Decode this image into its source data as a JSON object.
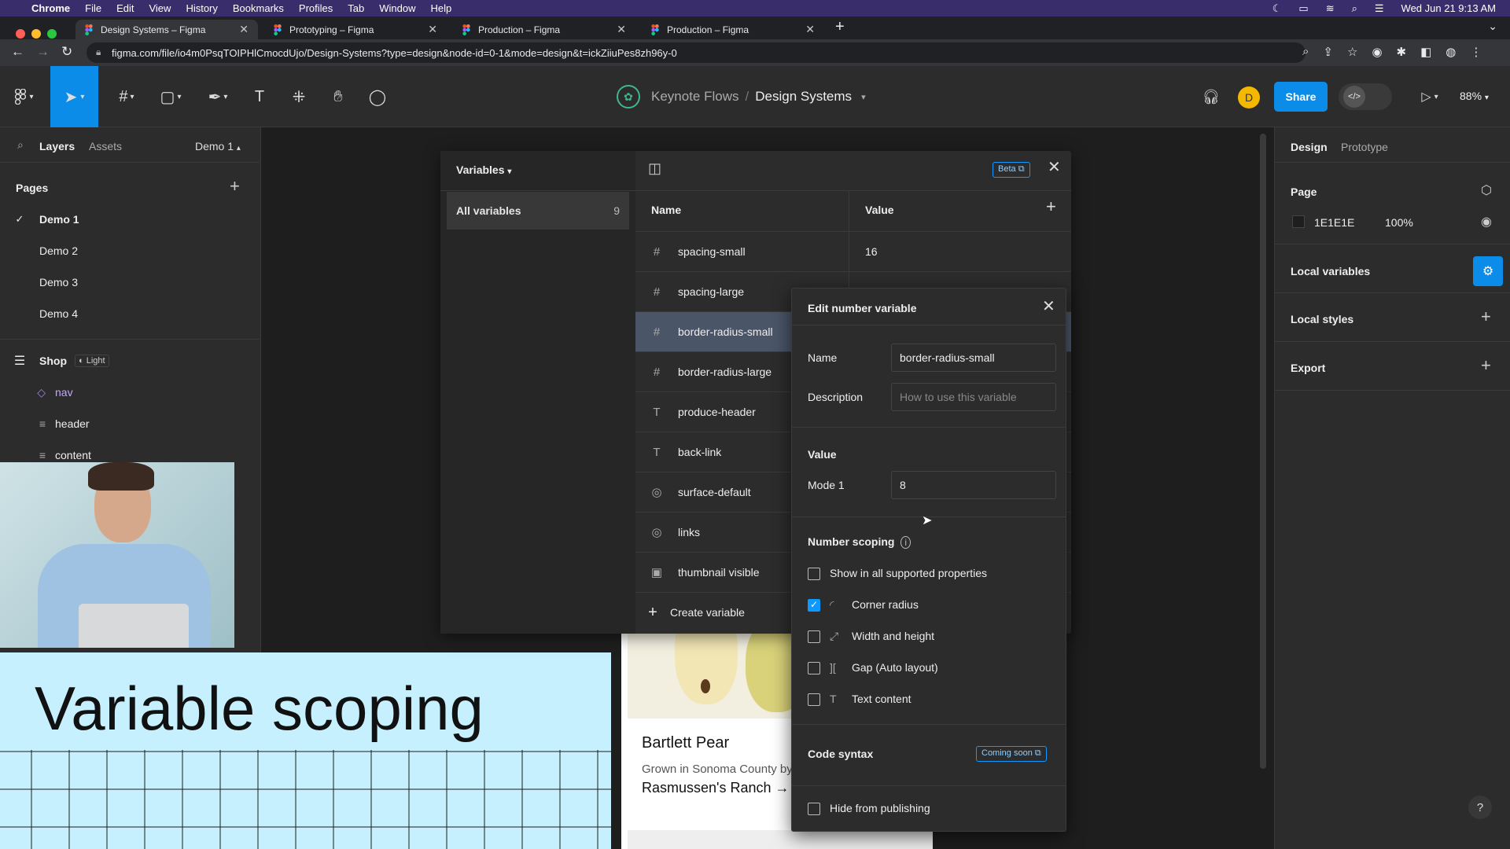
{
  "menubar": {
    "app": "Chrome",
    "items": [
      "File",
      "Edit",
      "View",
      "History",
      "Bookmarks",
      "Profiles",
      "Tab",
      "Window",
      "Help"
    ],
    "clock": "Wed Jun 21  9:13 AM"
  },
  "tabs": [
    {
      "title": "Design Systems – Figma",
      "active": true
    },
    {
      "title": "Prototyping – Figma",
      "active": false
    },
    {
      "title": "Production – Figma",
      "active": false
    },
    {
      "title": "Production – Figma",
      "active": false
    }
  ],
  "url": "figma.com/file/io4m0PsqTOIPHlCmocdUjo/Design-Systems?type=design&node-id=0-1&mode=design&t=ickZiiuPes8zh96y-0",
  "toolbar": {
    "project": "Keynote Flows",
    "separator": "/",
    "file": "Design Systems",
    "avatar": "D",
    "share": "Share",
    "zoom": "88%"
  },
  "left": {
    "tab_layers": "Layers",
    "tab_assets": "Assets",
    "page_switch": "Demo 1",
    "pages_title": "Pages",
    "pages": [
      "Demo 1",
      "Demo 2",
      "Demo 3",
      "Demo 4"
    ],
    "frame": "Shop",
    "frame_badge": "Light",
    "layers": [
      "nav",
      "header",
      "content"
    ]
  },
  "right": {
    "tab_design": "Design",
    "tab_prototype": "Prototype",
    "page_label": "Page",
    "page_color": "1E1E1E",
    "page_opacity": "100%",
    "local_variables": "Local variables",
    "local_styles": "Local styles",
    "export": "Export",
    "help": "?"
  },
  "variables": {
    "title": "Variables",
    "beta": "Beta",
    "collection": "All variables",
    "count": "9",
    "col_name": "Name",
    "col_value": "Value",
    "rows": [
      {
        "icon": "#",
        "name": "spacing-small",
        "value": "16"
      },
      {
        "icon": "#",
        "name": "spacing-large",
        "value": "24"
      },
      {
        "icon": "#",
        "name": "border-radius-small",
        "value": ""
      },
      {
        "icon": "#",
        "name": "border-radius-large",
        "value": ""
      },
      {
        "icon": "T",
        "name": "produce-header",
        "value": ""
      },
      {
        "icon": "T",
        "name": "back-link",
        "value": ""
      },
      {
        "icon": "◎",
        "name": "surface-default",
        "value": ""
      },
      {
        "icon": "◎",
        "name": "links",
        "value": ""
      },
      {
        "icon": "▣",
        "name": "thumbnail visible",
        "value": ""
      }
    ],
    "create": "Create variable"
  },
  "edit": {
    "title": "Edit number variable",
    "name_label": "Name",
    "name_value": "border-radius-small",
    "desc_label": "Description",
    "desc_placeholder": "How to use this variable",
    "value_title": "Value",
    "mode_label": "Mode 1",
    "mode_value": "8",
    "scoping_title": "Number scoping",
    "scopes": [
      {
        "label": "Show in all supported properties",
        "checked": false,
        "icon": ""
      },
      {
        "label": "Corner radius",
        "checked": true,
        "icon": "◜"
      },
      {
        "label": "Width and height",
        "checked": false,
        "icon": "⤢"
      },
      {
        "label": "Gap (Auto layout)",
        "checked": false,
        "icon": "]["
      },
      {
        "label": "Text content",
        "checked": false,
        "icon": "T"
      }
    ],
    "code_syntax": "Code syntax",
    "coming_soon": "Coming soon",
    "hide_publish": "Hide from publishing"
  },
  "slide": {
    "title": "Variable scoping"
  },
  "product": {
    "name": "Bartlett Pear",
    "desc": "Grown in Sonoma County by",
    "link": "Rasmussen's Ranch →"
  },
  "colors": {
    "accent": "#0d99ff",
    "share": "#0c8ce9",
    "avatar": "#f5b800",
    "menubar": "#3a2d6b",
    "board": "#c6f0fd"
  }
}
